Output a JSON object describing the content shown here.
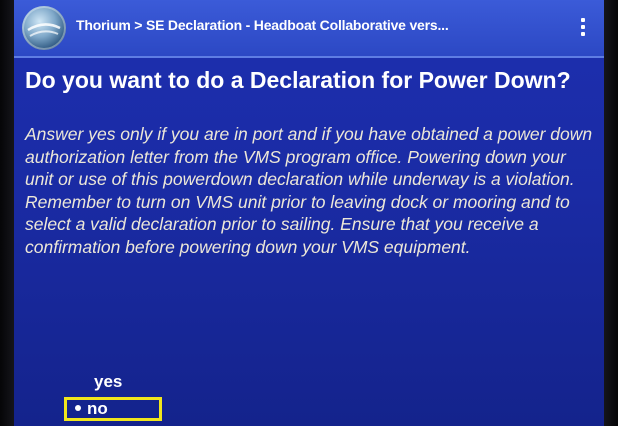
{
  "action_bar": {
    "title": "Thorium > SE Declaration - Headboat Collaborative vers..."
  },
  "question": {
    "text": "Do you want to do a Declaration for Power Down?"
  },
  "description": {
    "text": "Answer yes only if you are in port and if you have obtained a power down authorization letter from the VMS program office. Powering down your unit or use of this powerdown declaration while underway is a violation. Remember to turn on VMS unit prior to leaving dock or mooring and to select a valid declaration prior to sailing. Ensure that you receive a confirmation before powering down your VMS equipment."
  },
  "options": [
    {
      "label": "yes",
      "selected": false
    },
    {
      "label": "no",
      "selected": true
    }
  ],
  "colors": {
    "screen_background": "#1a2ba4",
    "action_bar": "#2c48c4",
    "highlight_border": "#f1e61c",
    "description_text": "#ece7d8"
  },
  "icons": {
    "app": "globe-icon",
    "menu": "overflow-menu-icon"
  }
}
